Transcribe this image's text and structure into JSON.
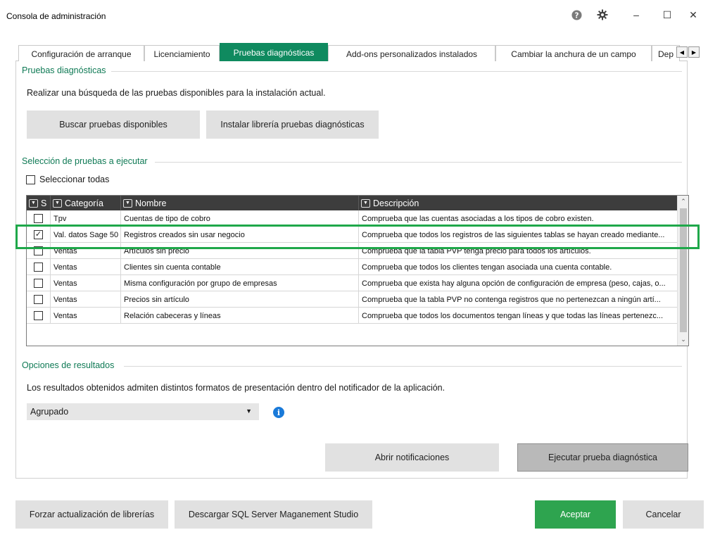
{
  "window": {
    "title": "Consola de administración",
    "controls": {
      "minimize": "–",
      "maximize": "☐",
      "close": "✕"
    }
  },
  "tabs": [
    {
      "label": "Configuración de arranque",
      "active": false
    },
    {
      "label": "Licenciamiento",
      "active": false
    },
    {
      "label": "Pruebas diagnósticas",
      "active": true
    },
    {
      "label": "Add-ons personalizados instalados",
      "active": false
    },
    {
      "label": "Cambiar la anchura de un campo",
      "active": false
    },
    {
      "label": "Dep",
      "active": false
    }
  ],
  "diagnostics": {
    "section_title": "Pruebas diagnósticas",
    "description": "Realizar una búsqueda de las pruebas disponibles para la instalación actual.",
    "search_button": "Buscar pruebas disponibles",
    "install_button": "Instalar librería pruebas diagnósticas"
  },
  "selection": {
    "section_title": "Selección de pruebas a ejecutar",
    "select_all_label": "Seleccionar todas",
    "select_all_checked": false,
    "columns": {
      "select": "S",
      "category": "Categoría",
      "name": "Nombre",
      "description": "Descripción"
    },
    "rows": [
      {
        "checked": false,
        "category": "Tpv",
        "name": "Cuentas de tipo de cobro",
        "description": "Comprueba que las cuentas asociadas a los tipos de cobro existen."
      },
      {
        "checked": true,
        "category": "Val. datos Sage 50",
        "name": "Registros creados sin usar negocio",
        "description": "Comprueba que todos los registros de las siguientes tablas se hayan creado mediante..."
      },
      {
        "checked": false,
        "category": "Ventas",
        "name": "Artículos sin precio",
        "description": "Comprueba que la tabla PVP tenga precio para todos los artículos."
      },
      {
        "checked": false,
        "category": "Ventas",
        "name": "Clientes sin cuenta contable",
        "description": "Comprueba que todos los clientes tengan asociada una cuenta contable."
      },
      {
        "checked": false,
        "category": "Ventas",
        "name": "Misma configuración por grupo de empresas",
        "description": "Comprueba que exista hay alguna opción de configuración de empresa (peso, cajas, o..."
      },
      {
        "checked": false,
        "category": "Ventas",
        "name": "Precios sin artículo",
        "description": "Comprueba que la tabla PVP no contenga registros que no pertenezcan a ningún artí..."
      },
      {
        "checked": false,
        "category": "Ventas",
        "name": "Relación cabeceras y líneas",
        "description": "Comprueba que todos los documentos tengan líneas y que todas las líneas pertenezc..."
      }
    ]
  },
  "results": {
    "section_title": "Opciones de resultados",
    "description": "Los resultados obtenidos admiten distintos formatos de presentación dentro del notificador de la aplicación.",
    "format_selected": "Agrupado",
    "open_notifications_button": "Abrir notificaciones",
    "run_button": "Ejecutar prueba diagnóstica"
  },
  "footer": {
    "force_update_button": "Forzar actualización de librerías",
    "download_sql_button": "Descargar SQL Server Maganement Studio",
    "accept_button": "Aceptar",
    "cancel_button": "Cancelar"
  },
  "colors": {
    "accent": "#0f8a5f",
    "accept": "#2ea44f",
    "highlight": "#1fa84a",
    "info": "#1a7ad9"
  }
}
